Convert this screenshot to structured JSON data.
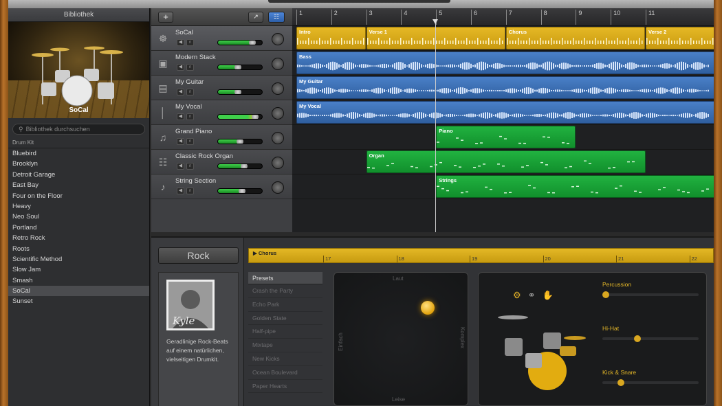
{
  "library": {
    "title": "Bibliothek",
    "drum_caption": "SoCal",
    "search_placeholder": "Bibliothek durchsuchen",
    "category": "Drum Kit",
    "items": [
      "Bluebird",
      "Brooklyn",
      "Detroit Garage",
      "East Bay",
      "Four on the Floor",
      "Heavy",
      "Neo Soul",
      "Portland",
      "Retro Rock",
      "Roots",
      "Scientific Method",
      "Slow Jam",
      "Smash",
      "SoCal",
      "Sunset"
    ],
    "selected_index": 13
  },
  "toolbar": {
    "add_label": "+"
  },
  "tracks": [
    {
      "name": "SoCal",
      "icon": "drums-icon",
      "color": "yellow",
      "level": 0.78
    },
    {
      "name": "Modern Stack",
      "icon": "amp-icon",
      "color": "blue",
      "level": 0.45
    },
    {
      "name": "My Guitar",
      "icon": "guitar-amp-icon",
      "color": "blue",
      "level": 0.45
    },
    {
      "name": "My Vocal",
      "icon": "microphone-icon",
      "color": "blue",
      "level": 0.85
    },
    {
      "name": "Grand Piano",
      "icon": "piano-icon",
      "color": "green",
      "level": 0.5
    },
    {
      "name": "Classic Rock Organ",
      "icon": "organ-icon",
      "color": "green",
      "level": 0.6
    },
    {
      "name": "String Section",
      "icon": "violin-icon",
      "color": "green",
      "level": 0.55
    }
  ],
  "ruler": {
    "bars": [
      "1",
      "2",
      "3",
      "4",
      "5",
      "6",
      "7",
      "8",
      "9",
      "10",
      "11"
    ]
  },
  "regions": {
    "drums": [
      {
        "label": "Intro",
        "start": 1,
        "end": 3
      },
      {
        "label": "Verse 1",
        "start": 3,
        "end": 7
      },
      {
        "label": "Chorus",
        "start": 7,
        "end": 11
      },
      {
        "label": "Verse 2",
        "start": 11,
        "end": 13
      }
    ],
    "bass_label": "Bass",
    "guitar_label": "My Guitar",
    "vocal_label": "My Vocal",
    "piano_label": "Piano",
    "organ_label": "Organ",
    "strings_label": "Strings"
  },
  "editor": {
    "genre": "Rock",
    "drummer_signature": "Kyle",
    "drummer_desc": "Geradlinige Rock-Beats auf einem natürlichen, vielseitigen Drumkit.",
    "region_name": "Chorus",
    "ruler_ticks": [
      "17",
      "18",
      "19",
      "20",
      "21",
      "22"
    ],
    "presets_title": "Presets",
    "presets": [
      "Crash the Party",
      "Echo Park",
      "Golden State",
      "Half-pipe",
      "Mixtape",
      "New Kicks",
      "Ocean Boulevard",
      "Paper Hearts"
    ],
    "xy_labels": {
      "top": "Laut",
      "bottom": "Leise",
      "left": "Einfach",
      "right": "Komplex"
    },
    "sliders": [
      {
        "label": "Percussion",
        "value": 0.02
      },
      {
        "label": "Hi-Hat",
        "value": 0.35
      },
      {
        "label": "Kick & Snare",
        "value": 0.18
      }
    ]
  },
  "colors": {
    "yellow": "#d9a919",
    "blue": "#3d6fb4",
    "green": "#18a236",
    "accent": "#e5b828"
  }
}
